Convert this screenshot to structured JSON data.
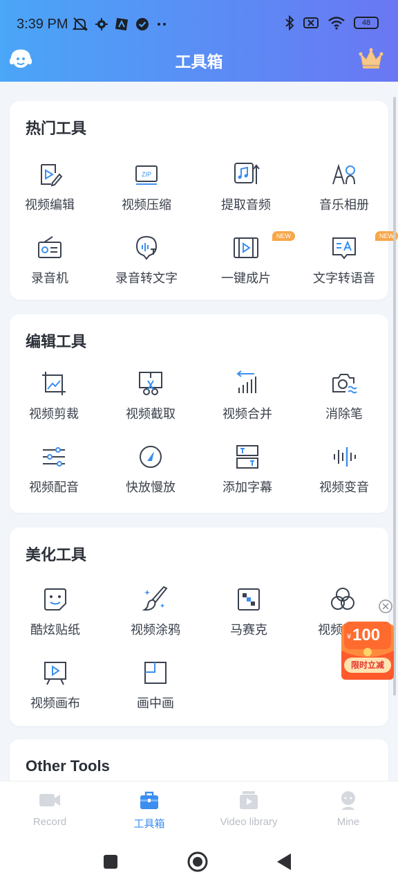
{
  "status_bar": {
    "time": "3:39 PM",
    "battery": "48"
  },
  "app_bar": {
    "title": "工具箱"
  },
  "sections": {
    "hot": {
      "title": "热门工具",
      "items": [
        {
          "label": "视频编辑",
          "icon": "video-edit-icon"
        },
        {
          "label": "视频压缩",
          "icon": "zip-icon"
        },
        {
          "label": "提取音频",
          "icon": "extract-audio-icon"
        },
        {
          "label": "音乐相册",
          "icon": "music-album-icon"
        },
        {
          "label": "录音机",
          "icon": "radio-recorder-icon"
        },
        {
          "label": "录音转文字",
          "icon": "voice-to-text-icon"
        },
        {
          "label": "一键成片",
          "icon": "film-strip-icon",
          "badge": "NEW"
        },
        {
          "label": "文字转语音",
          "icon": "text-to-speech-icon",
          "badge": "NEW"
        }
      ]
    },
    "edit": {
      "title": "编辑工具",
      "items": [
        {
          "label": "视频剪裁",
          "icon": "crop-icon"
        },
        {
          "label": "视频截取",
          "icon": "scissors-icon"
        },
        {
          "label": "视频合并",
          "icon": "merge-icon"
        },
        {
          "label": "消除笔",
          "icon": "eraser-camera-icon"
        },
        {
          "label": "视频配音",
          "icon": "sliders-icon"
        },
        {
          "label": "快放慢放",
          "icon": "speed-gauge-icon"
        },
        {
          "label": "添加字幕",
          "icon": "subtitle-icon"
        },
        {
          "label": "视频变音",
          "icon": "voice-change-icon"
        }
      ]
    },
    "beautify": {
      "title": "美化工具",
      "items": [
        {
          "label": "酷炫贴纸",
          "icon": "sticker-icon"
        },
        {
          "label": "视频涂鸦",
          "icon": "brush-icon"
        },
        {
          "label": "马赛克",
          "icon": "mosaic-icon"
        },
        {
          "label": "视频滤镜",
          "icon": "filter-icon"
        },
        {
          "label": "视频画布",
          "icon": "canvas-icon"
        },
        {
          "label": "画中画",
          "icon": "pip-icon"
        }
      ]
    },
    "other": {
      "title": "Other Tools"
    }
  },
  "promo": {
    "currency": "¥",
    "amount": "100",
    "cta": "限时立减"
  },
  "bottom_nav": [
    {
      "label": "Record",
      "icon": "video-camera-icon",
      "active": false
    },
    {
      "label": "工具箱",
      "icon": "toolbox-icon",
      "active": true
    },
    {
      "label": "Video library",
      "icon": "video-library-icon",
      "active": false
    },
    {
      "label": "Mine",
      "icon": "profile-icon",
      "active": false
    }
  ],
  "colors": {
    "accent": "#3b8ef0",
    "badge": "#f7a64a",
    "promo_red": "#e4362d"
  }
}
